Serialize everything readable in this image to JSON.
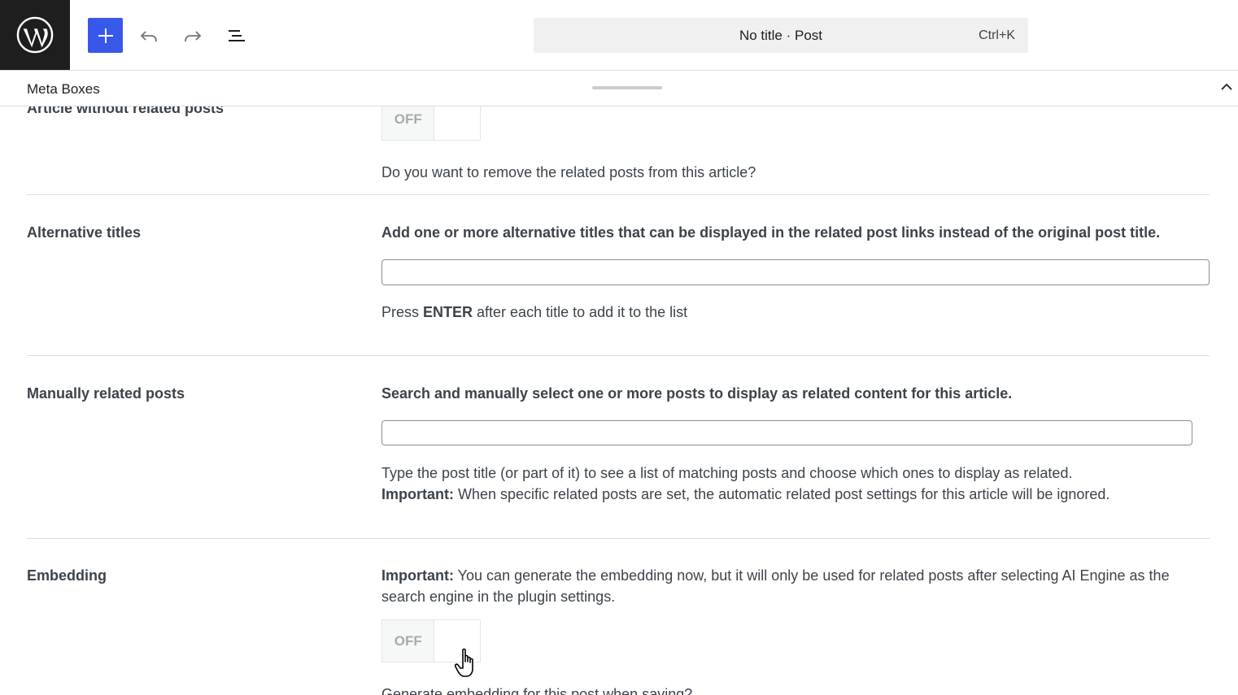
{
  "toolbar": {
    "add_block_label": "Add block",
    "undo_label": "Undo",
    "redo_label": "Redo",
    "document_overview_label": "Document Overview"
  },
  "command_bar": {
    "title": "No title · Post",
    "shortcut": "Ctrl+K"
  },
  "meta_boxes": {
    "title": "Meta Boxes"
  },
  "sections": {
    "article_without_related": {
      "label": "Article without related posts",
      "toggle_state": "OFF",
      "description": "Do you want to remove the related posts from this article?"
    },
    "alternative_titles": {
      "label": "Alternative titles",
      "lead": "Add one or more alternative titles that can be displayed in the related post links instead of the original post title.",
      "input_value": "",
      "help_pre": "Press ",
      "help_key": "ENTER",
      "help_post": " after each title to add it to the list"
    },
    "manually_related": {
      "label": "Manually related posts",
      "lead": "Search and manually select one or more posts to display as related content for this article.",
      "input_value": "",
      "help_line1": "Type the post title (or part of it) to see a list of matching posts and choose which ones to display as related.",
      "help_important": "Important:",
      "help_line2": " When specific related posts are set, the automatic related post settings for this article will be ignored."
    },
    "embedding": {
      "label": "Embedding",
      "important": "Important:",
      "note": " You can generate the embedding now, but it will only be used for related posts after selecting AI Engine as the search engine in the plugin settings.",
      "toggle_state": "OFF",
      "description": "Generate embedding for this post when saving?"
    }
  },
  "icons": {
    "logo": "wordpress-icon",
    "add": "plus-icon",
    "undo": "undo-icon",
    "redo": "redo-icon",
    "list": "list-view-icon",
    "collapse": "chevron-up-icon",
    "cursor": "hand-pointer-icon"
  },
  "colors": {
    "accent": "#3858e9",
    "sidebar_dark": "#1e1e1e",
    "command_bg": "#f0f0f0"
  }
}
